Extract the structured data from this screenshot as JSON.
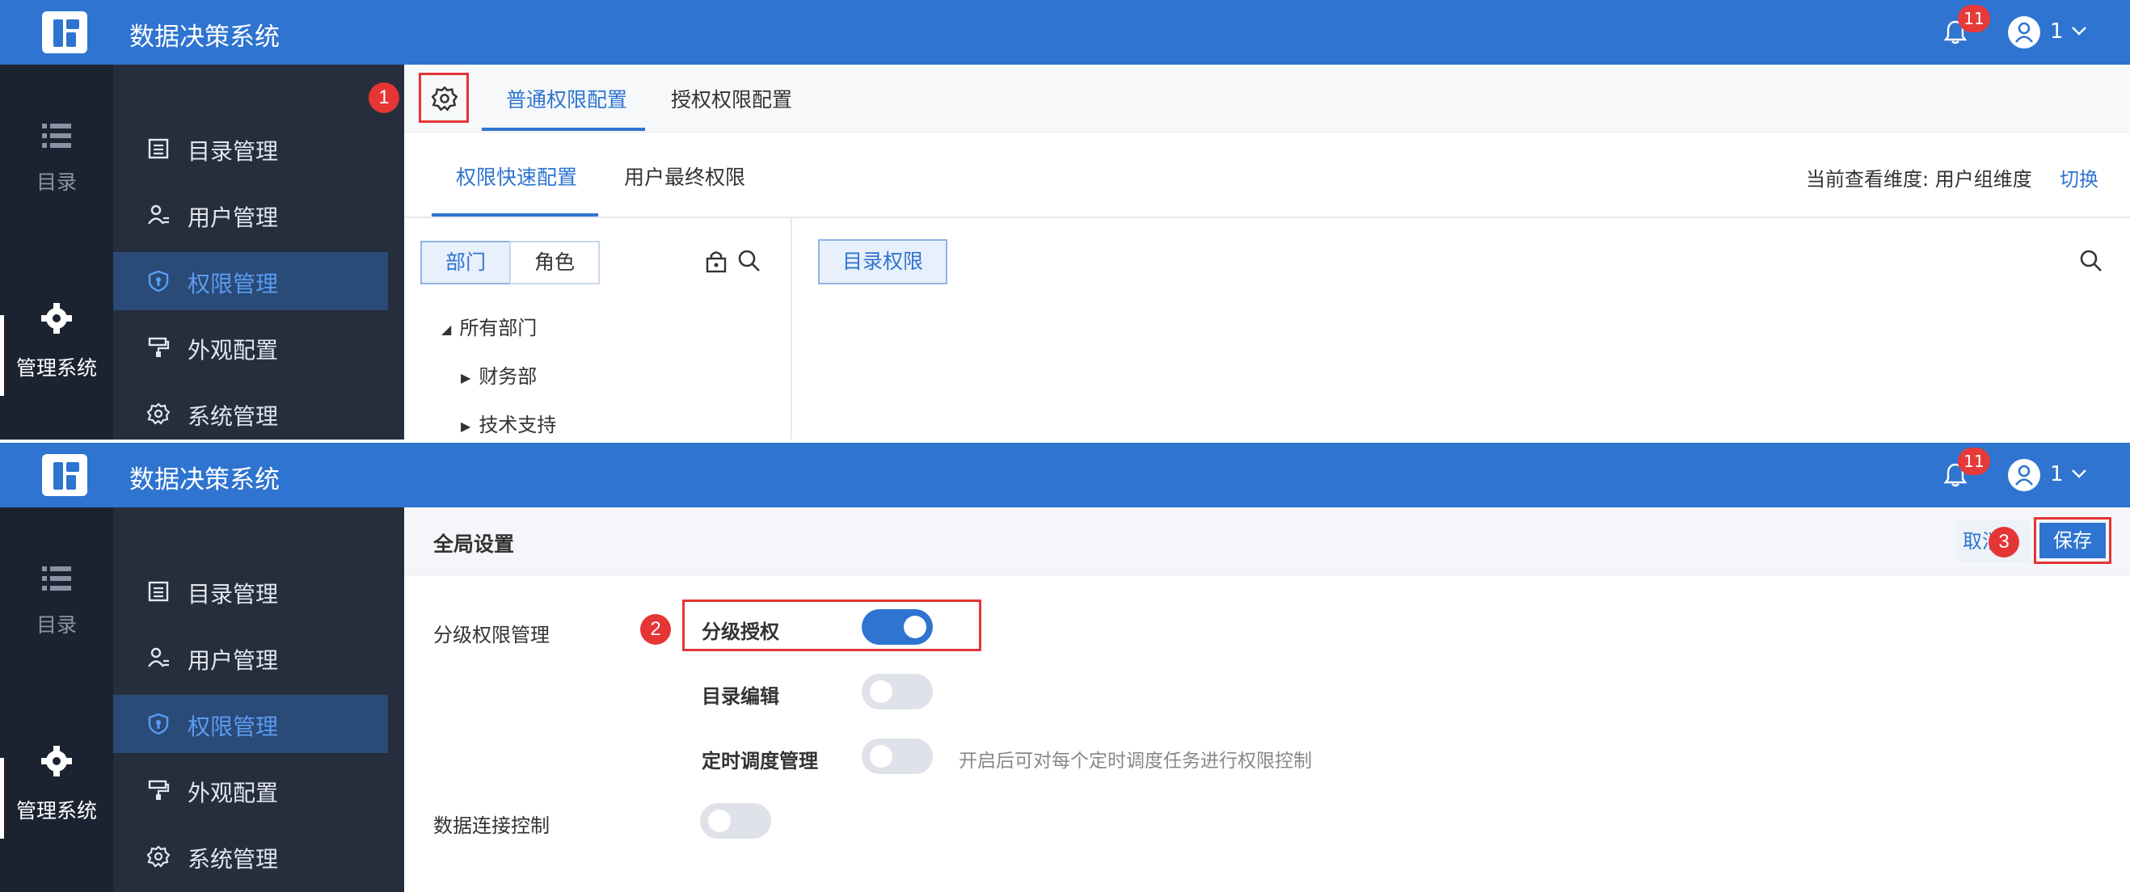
{
  "app": {
    "title": "数据决策系统",
    "notification_count": "11",
    "user_name": "1"
  },
  "rail": {
    "catalog_label": "目录",
    "admin_label": "管理系统"
  },
  "menu": {
    "items": [
      {
        "label": "目录管理",
        "icon": "list-icon"
      },
      {
        "label": "用户管理",
        "icon": "user-icon"
      },
      {
        "label": "权限管理",
        "icon": "shield-icon"
      },
      {
        "label": "外观配置",
        "icon": "paint-roller-icon"
      },
      {
        "label": "系统管理",
        "icon": "gear-icon"
      }
    ],
    "active_index": 2
  },
  "panel1": {
    "tabs": [
      "普通权限配置",
      "授权权限配置"
    ],
    "subtabs": [
      "权限快速配置",
      "用户最终权限"
    ],
    "dimension_label": "当前查看维度: 用户组维度",
    "switch_label": "切换",
    "segments": [
      "部门",
      "角色"
    ],
    "tree": {
      "root": "所有部门",
      "children": [
        "财务部",
        "技术支持"
      ]
    },
    "catalog_permission_label": "目录权限",
    "marker": "1"
  },
  "panel2": {
    "title": "全局设置",
    "cancel_label": "取消",
    "save_label": "保存",
    "section_label": "分级权限管理",
    "grading_label": "分级授权",
    "grading_on": true,
    "catalog_edit_label": "目录编辑",
    "catalog_edit_on": false,
    "schedule_label": "定时调度管理",
    "schedule_on": false,
    "schedule_hint": "开启后可对每个定时调度任务进行权限控制",
    "data_connection_label": "数据连接控制",
    "data_connection_on": false,
    "marker2": "2",
    "marker3": "3"
  },
  "colors": {
    "brand_blue": "#2e74d0",
    "marker_red": "#e53535",
    "rail_dark": "#1c2330",
    "menu_dark": "#262e3d"
  }
}
